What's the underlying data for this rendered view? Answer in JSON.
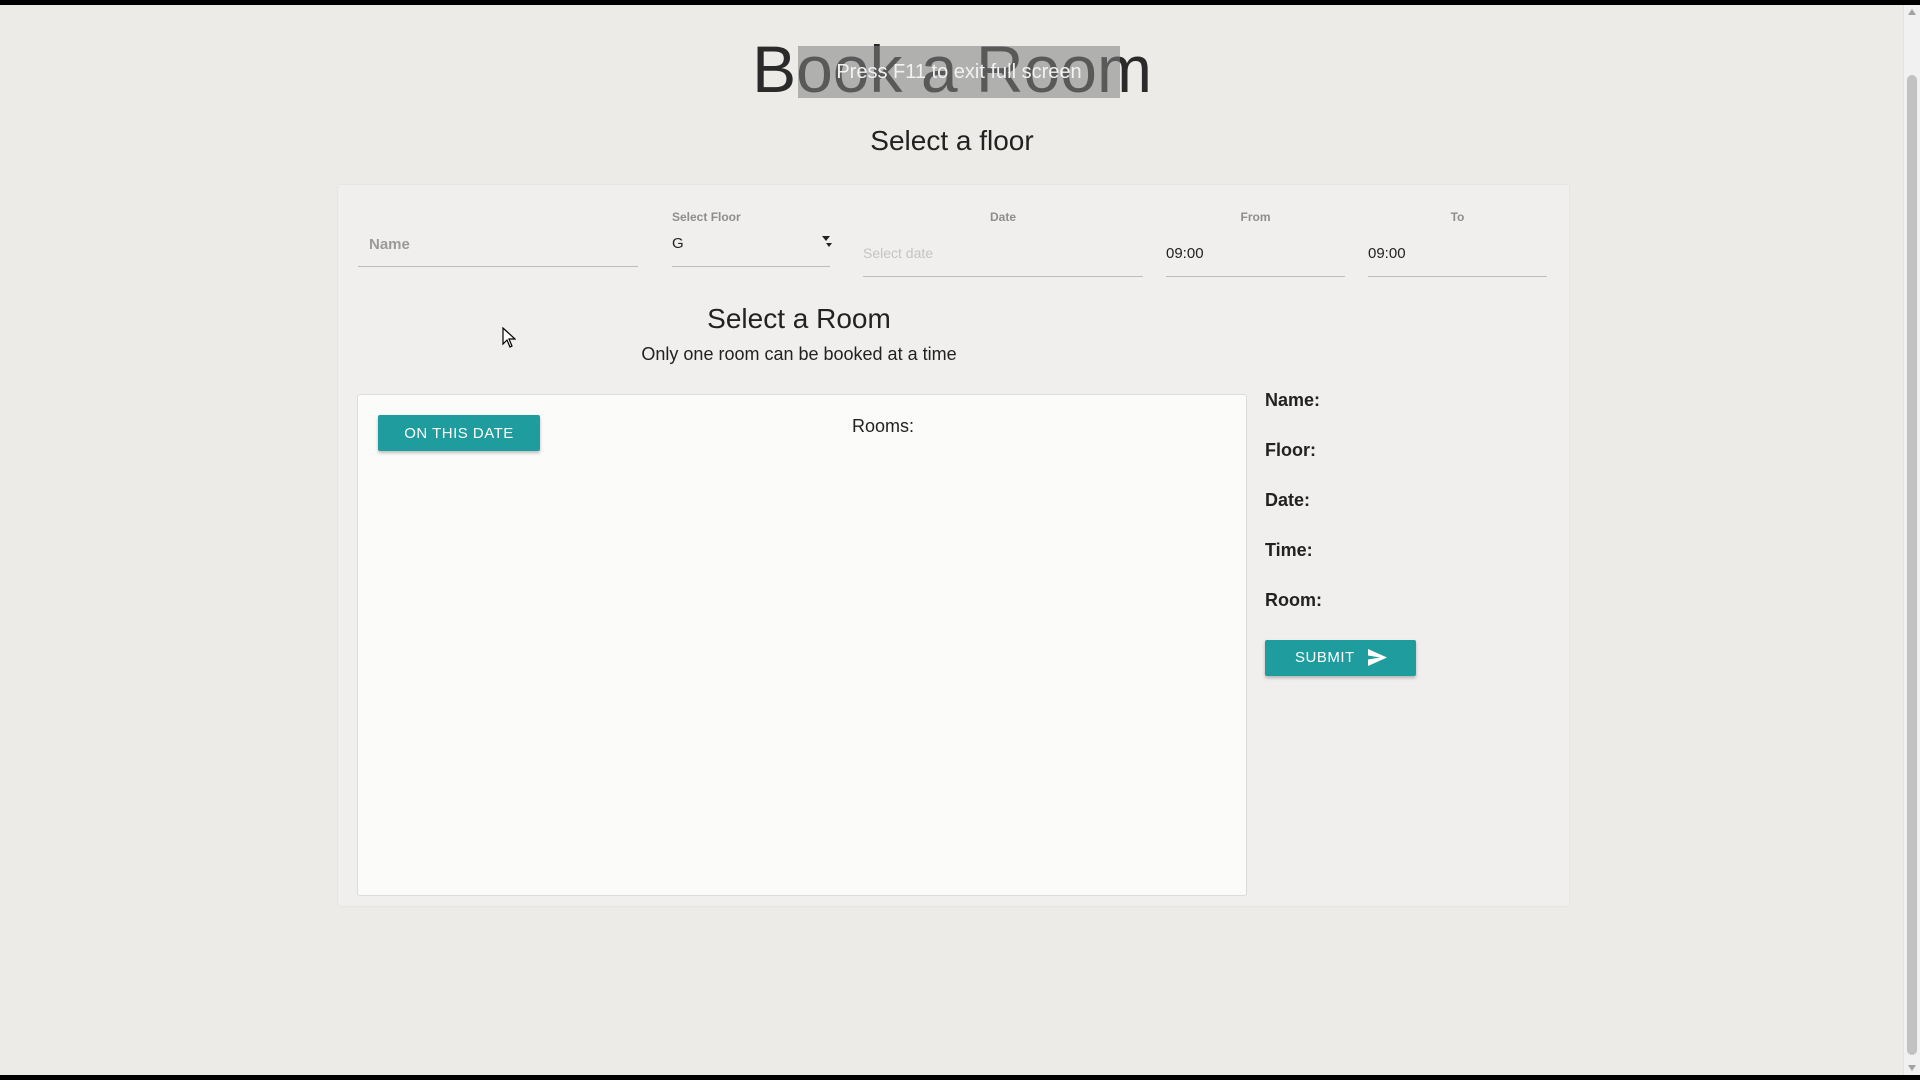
{
  "page": {
    "title": "Book a Room",
    "fullscreen_notice": "Press  F11  to exit full screen",
    "subtitle": "Select a floor"
  },
  "form": {
    "name_placeholder": "Name",
    "floor_label": "Select Floor",
    "floor_value": "G",
    "date_label": "Date",
    "date_placeholder": "Select date",
    "from_label": "From",
    "from_value": "09:00",
    "to_label": "To",
    "to_value": "09:00"
  },
  "rooms_section": {
    "title": "Select a Room",
    "note": "Only one room can be booked at a time",
    "on_this_date_button": "ON THIS DATE",
    "rooms_label": "Rooms:"
  },
  "summary": {
    "name_label": "Name:",
    "floor_label": "Floor:",
    "date_label": "Date:",
    "time_label": "Time:",
    "room_label": "Room:",
    "submit_label": "SUBMIT",
    "submit_icon": "send-icon"
  },
  "colors": {
    "accent": "#1f9c9e",
    "background": "#ecebe8",
    "panel": "#f0efed"
  }
}
